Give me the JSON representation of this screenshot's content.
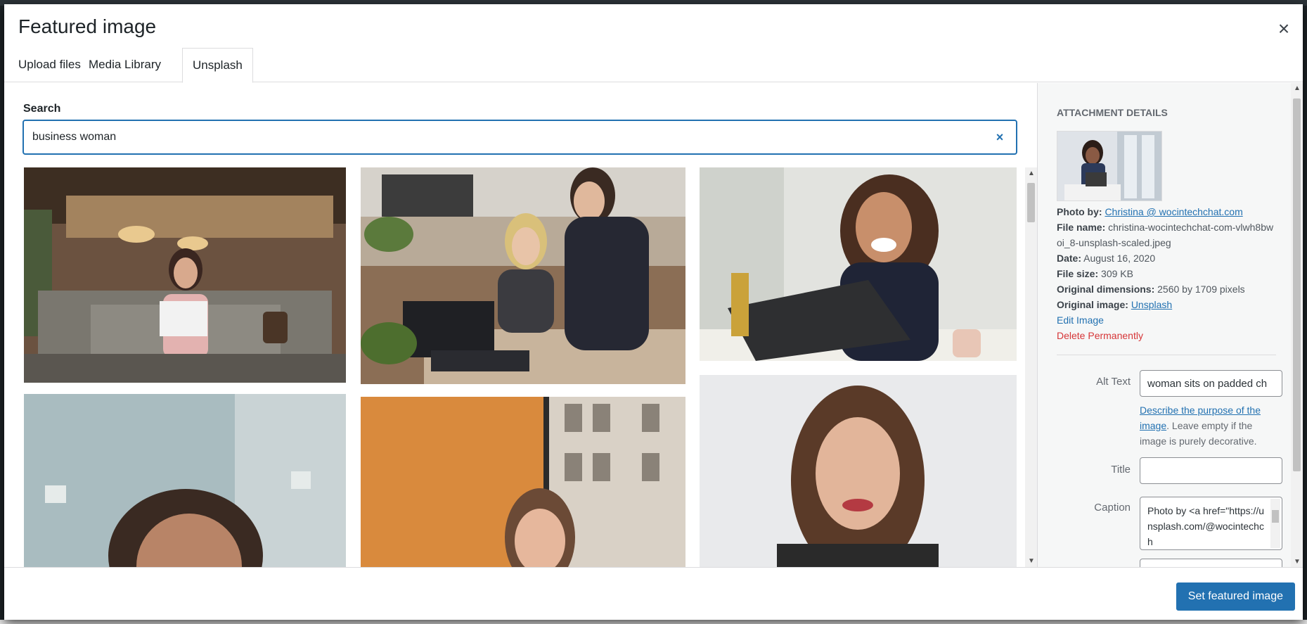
{
  "modal": {
    "title": "Featured image",
    "close_icon": "×"
  },
  "tabs": [
    {
      "label": "Upload files",
      "active": false
    },
    {
      "label": "Media Library",
      "active": false
    },
    {
      "label": "Unsplash",
      "active": true
    }
  ],
  "search": {
    "label": "Search",
    "value": "business woman",
    "clear_icon": "×"
  },
  "photos": [
    {
      "alt": "woman sitting on sofa with laptop in lounge"
    },
    {
      "alt": "two women working at laptop"
    },
    {
      "alt": "laughing woman at laptop"
    },
    {
      "alt": "smiling curly-haired woman portrait"
    },
    {
      "alt": "smiling woman in front of orange wall"
    },
    {
      "alt": "smiling woman portrait on white background"
    }
  ],
  "attachment": {
    "heading": "Attachment Details",
    "photo_by_label": "Photo by:",
    "photo_by_value": "Christina @ wocintechchat.com",
    "file_name_label": "File name:",
    "file_name_value": "christina-wocintechchat-com-vlwh8bwoi_8-unsplash-scaled.jpeg",
    "date_label": "Date:",
    "date_value": "August 16, 2020",
    "file_size_label": "File size:",
    "file_size_value": "309 KB",
    "dimensions_label": "Original dimensions:",
    "dimensions_value": "2560 by 1709 pixels",
    "original_label": "Original image:",
    "original_value": "Unsplash",
    "edit_link": "Edit Image",
    "delete_link": "Delete Permanently"
  },
  "fields": {
    "alt_label": "Alt Text",
    "alt_value": "woman sits on padded ch",
    "alt_help_link": "Describe the purpose of the image",
    "alt_help_text": ". Leave empty if the image is purely decorative.",
    "title_label": "Title",
    "title_value": "",
    "caption_label": "Caption",
    "caption_value": "Photo by <a href=\"https://unsplash.com/@wocintechch"
  },
  "toolbar": {
    "primary_label": "Set featured image"
  },
  "colors": {
    "accent": "#2271b1",
    "delete": "#d63638"
  }
}
